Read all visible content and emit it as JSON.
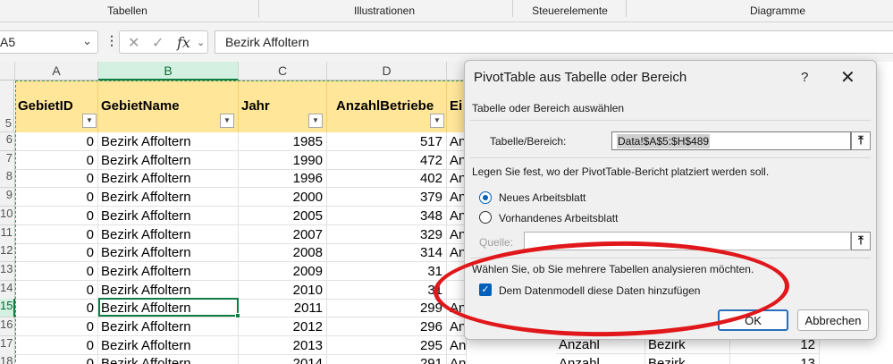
{
  "ribbon": {
    "groups": [
      "Tabellen",
      "Illustrationen",
      "Steuerelemente",
      "Diagramme"
    ]
  },
  "formula_bar": {
    "name_box": "A5",
    "formula_value": "Bezirk Affoltern",
    "icons": [
      "chevron-down-icon",
      "more-vertical-icon",
      "cancel-x-icon",
      "enter-check-icon",
      "fx-icon"
    ]
  },
  "sheet": {
    "columns": [
      "A",
      "B",
      "C",
      "D"
    ],
    "selected_column": "B",
    "header_row_number": "5",
    "headers": [
      "GebietID",
      "GebietName",
      "Jahr",
      "AnzahlBetriebe",
      "Ei"
    ],
    "rows": [
      {
        "row": "6",
        "id": "0",
        "name": "Bezirk Affoltern",
        "jahr": "1985",
        "anzahl": "517",
        "e": "An"
      },
      {
        "row": "7",
        "id": "0",
        "name": "Bezirk Affoltern",
        "jahr": "1990",
        "anzahl": "472",
        "e": "An"
      },
      {
        "row": "8",
        "id": "0",
        "name": "Bezirk Affoltern",
        "jahr": "1996",
        "anzahl": "402",
        "e": "An"
      },
      {
        "row": "9",
        "id": "0",
        "name": "Bezirk Affoltern",
        "jahr": "2000",
        "anzahl": "379",
        "e": "An"
      },
      {
        "row": "10",
        "id": "0",
        "name": "Bezirk Affoltern",
        "jahr": "2005",
        "anzahl": "348",
        "e": "An"
      },
      {
        "row": "11",
        "id": "0",
        "name": "Bezirk Affoltern",
        "jahr": "2007",
        "anzahl": "329",
        "e": "An"
      },
      {
        "row": "12",
        "id": "0",
        "name": "Bezirk Affoltern",
        "jahr": "2008",
        "anzahl": "314",
        "e": "An"
      },
      {
        "row": "13",
        "id": "0",
        "name": "Bezirk Affoltern",
        "jahr": "2009",
        "anzahl": "31",
        "e": ""
      },
      {
        "row": "14",
        "id": "0",
        "name": "Bezirk Affoltern",
        "jahr": "2010",
        "anzahl": "31",
        "e": ""
      },
      {
        "row": "15",
        "id": "0",
        "name": "Bezirk Affoltern",
        "jahr": "2011",
        "anzahl": "299",
        "e": "An"
      },
      {
        "row": "16",
        "id": "0",
        "name": "Bezirk Affoltern",
        "jahr": "2012",
        "anzahl": "296",
        "e": "An"
      },
      {
        "row": "17",
        "id": "0",
        "name": "Bezirk Affoltern",
        "jahr": "2013",
        "anzahl": "295",
        "e": "Anz."
      },
      {
        "row": "18",
        "id": "0",
        "name": "Bezirk Affoltern",
        "jahr": "2014",
        "anzahl": "291",
        "e": "Anz."
      }
    ],
    "behind_dialog": [
      {
        "f": "Anzahl",
        "g": "Bezirk",
        "h": "12"
      },
      {
        "f": "Anzahl",
        "g": "Bezirk",
        "h": "13"
      }
    ]
  },
  "dialog": {
    "title": "PivotTable aus Tabelle oder Bereich",
    "help": "?",
    "close": "✕",
    "section_select": "Tabelle oder Bereich auswählen",
    "range_label": "Tabelle/Bereich:",
    "range_value": "Data!$A$5:$H$489",
    "placement_prompt": "Legen Sie fest, wo der PivotTable-Bericht platziert werden soll.",
    "option_new": "Neues Arbeitsblatt",
    "option_existing": "Vorhandenes Arbeitsblatt",
    "source_label": "Quelle:",
    "multi_prompt": "Wählen Sie, ob Sie mehrere Tabellen analysieren möchten.",
    "datamodel_label": "Dem Datenmodell diese Daten hinzufügen",
    "datamodel_checked": true,
    "ok": "OK",
    "cancel": "Abbrechen"
  },
  "colors": {
    "header_fill": "#ffe699",
    "excel_green": "#107c41",
    "accent_blue": "#005fb8",
    "annotation_red": "#e0181b"
  }
}
